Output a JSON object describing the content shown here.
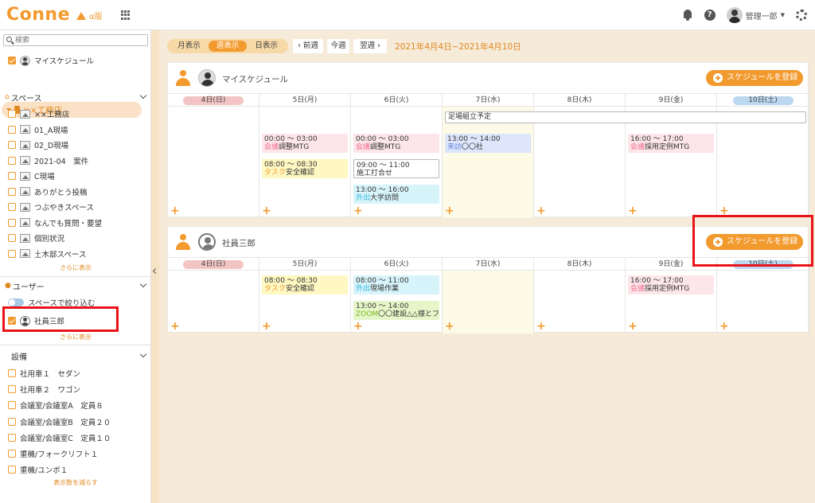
{
  "header": {
    "logo": "Conne",
    "edition": "α版",
    "user_name": "管理一郎"
  },
  "sidebar": {
    "search_placeholder": "検索",
    "my_schedule": "マイスケジュール",
    "store": "××工務店",
    "spaces_title": "スペース",
    "spaces": [
      "××工務店",
      "01_A現場",
      "02_D現場",
      "2021-04　案件",
      "C現場",
      "ありがとう投稿",
      "つぶやきスペース",
      "なんでも質問・要望",
      "個別状況",
      "土木部スペース"
    ],
    "spaces_more": "さらに表示",
    "users_title": "ユーザー",
    "users_filter": "スペースで絞り込む",
    "users": [
      "社員三郎"
    ],
    "users_more": "さらに表示",
    "equipment_title": "設備",
    "equipment": [
      "社用車１　セダン",
      "社用車２　ワゴン",
      "会議室/会議室A　定員８",
      "会議室/会議室B　定員２０",
      "会議室/会議室C　定員１０",
      "重機/フォークリフト１",
      "重機/ユンボ１"
    ],
    "equipment_less": "表示数を減らす"
  },
  "toolbar": {
    "view_month": "月表示",
    "view_week": "週表示",
    "view_day": "日表示",
    "prev": "‹ 前週",
    "this_week": "今週",
    "next": "翌週 ›",
    "date_range": "2021年4月4日~2021年4月10日"
  },
  "days": [
    "4日(日)",
    "5日(月)",
    "6日(火)",
    "7日(水)",
    "8日(木)",
    "9日(金)",
    "10日(土)"
  ],
  "add_label": "スケジュールを登録",
  "panels": [
    {
      "name": "マイスケジュール",
      "allday": "足場組立予定",
      "events": [
        {
          "time": "00:00 ～ 03:00",
          "cat": "会議",
          "title": "調整MTG"
        },
        {
          "time": "08:00 ～ 08:30",
          "cat": "タスク",
          "title": "安全確認"
        },
        {
          "time": "00:00 ～ 03:00",
          "cat": "会議",
          "title": "調整MTG"
        },
        {
          "time": "09:00 ～ 11:00",
          "cat": "",
          "title": "施工打合せ"
        },
        {
          "time": "13:00 ～ 16:00",
          "cat": "外出",
          "title": "大学訪問"
        },
        {
          "time": "13:00 ～ 14:00",
          "cat": "来訪",
          "title": "〇〇社"
        },
        {
          "time": "16:00 ～ 17:00",
          "cat": "会議",
          "title": "採用定例MTG"
        }
      ]
    },
    {
      "name": "社員三郎",
      "events": [
        {
          "time": "08:00 ～ 08:30",
          "cat": "タスク",
          "title": "安全確認"
        },
        {
          "time": "08:00 ～ 11:00",
          "cat": "外出",
          "title": "現場作業"
        },
        {
          "time": "13:00 ～ 14:00",
          "cat": "ZOOM",
          "title": "〇〇建設△△様とフ"
        },
        {
          "time": "16:00 ～ 17:00",
          "cat": "会議",
          "title": "採用定例MTG"
        }
      ]
    }
  ],
  "colors": {
    "accent": "#f29a2e",
    "highlight": "#e8141a",
    "background": "#f6ead8"
  }
}
